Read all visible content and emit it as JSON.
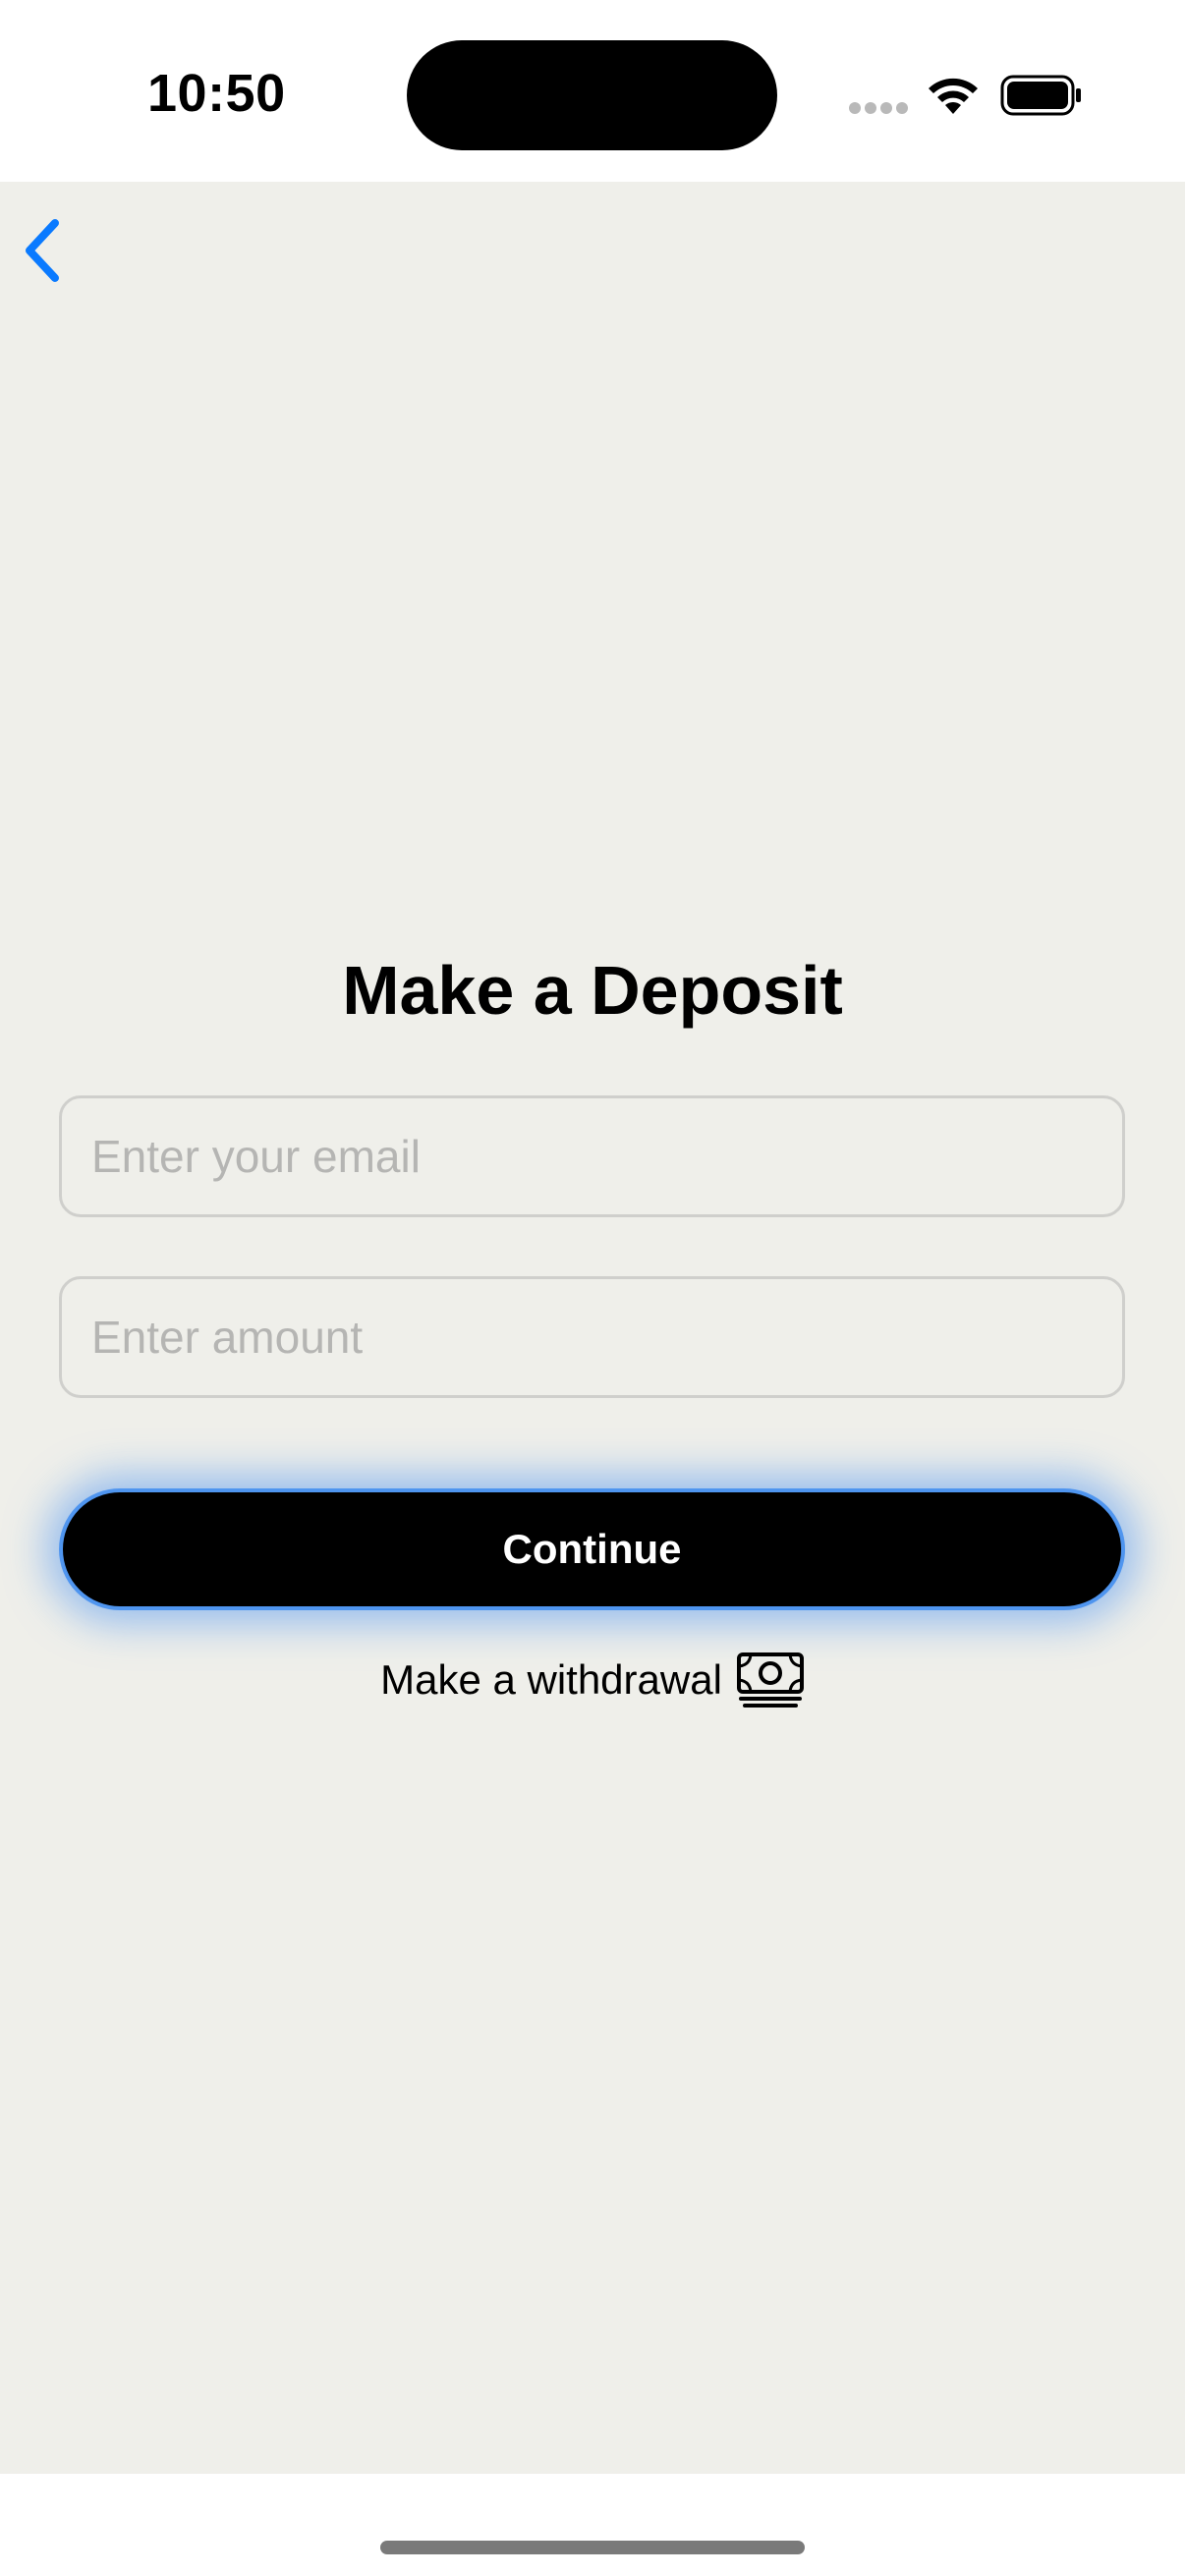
{
  "status_bar": {
    "time": "10:50",
    "icons": [
      "signal-dots-icon",
      "wifi-icon",
      "battery-icon"
    ]
  },
  "nav": {
    "back_icon": "chevron-left-icon",
    "accent_color": "#0a7aff"
  },
  "main": {
    "title": "Make a Deposit",
    "email_field": {
      "placeholder": "Enter your email",
      "value": ""
    },
    "amount_field": {
      "placeholder": "Enter amount",
      "value": ""
    },
    "continue_label": "Continue",
    "withdraw_label": "Make a withdrawal",
    "withdraw_icon": "money-icon"
  },
  "colors": {
    "background": "#efefea",
    "button": "#000000",
    "button_glow": "#4f95ef"
  }
}
